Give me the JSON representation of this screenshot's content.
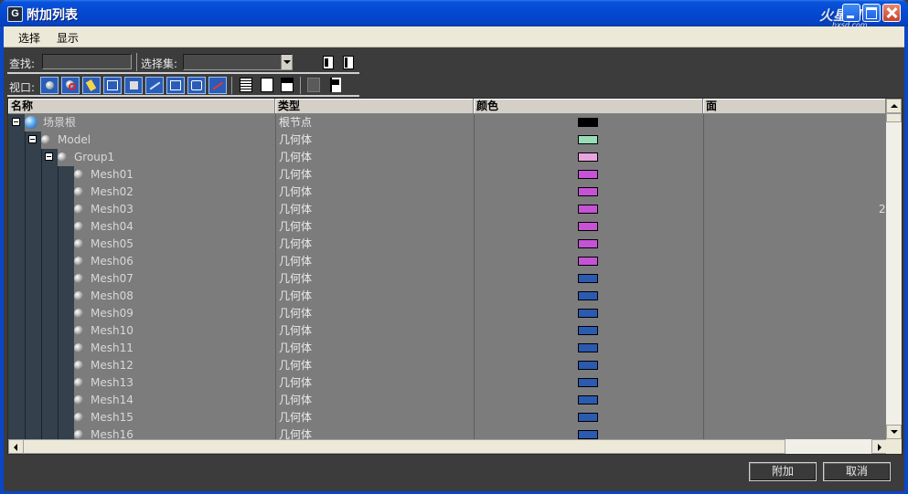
{
  "window": {
    "title": "附加列表",
    "app_icon_label": "G"
  },
  "watermark": {
    "main": "火星网",
    "sub": "hxsd.com"
  },
  "menu": {
    "items": [
      "选择",
      "显示"
    ]
  },
  "toolbar": {
    "find_label": "查找:",
    "find_value": "",
    "selection_set_label": "选择集:",
    "selection_set_value": "",
    "viewport_label": "视口:"
  },
  "list": {
    "columns": [
      "名称",
      "类型",
      "颜色",
      "面"
    ],
    "visible_face_value": "2",
    "rows": [
      {
        "name": "场景根",
        "type": "根节点",
        "color": "#000000",
        "level": 0,
        "icon": "globe-icon",
        "expandable": true
      },
      {
        "name": "Model",
        "type": "几何体",
        "color": "#99dcb8",
        "level": 1,
        "icon": "node-icon",
        "expandable": true
      },
      {
        "name": "Group1",
        "type": "几何体",
        "color": "#e8a4de",
        "level": 2,
        "icon": "node-icon",
        "expandable": true
      },
      {
        "name": "Mesh01",
        "type": "几何体",
        "color": "#c652d6",
        "level": 3,
        "icon": "node-icon",
        "expandable": false
      },
      {
        "name": "Mesh02",
        "type": "几何体",
        "color": "#c652d6",
        "level": 3,
        "icon": "node-icon",
        "expandable": false
      },
      {
        "name": "Mesh03",
        "type": "几何体",
        "color": "#c652d6",
        "level": 3,
        "icon": "node-icon",
        "expandable": false
      },
      {
        "name": "Mesh04",
        "type": "几何体",
        "color": "#c652d6",
        "level": 3,
        "icon": "node-icon",
        "expandable": false
      },
      {
        "name": "Mesh05",
        "type": "几何体",
        "color": "#c652d6",
        "level": 3,
        "icon": "node-icon",
        "expandable": false
      },
      {
        "name": "Mesh06",
        "type": "几何体",
        "color": "#c652d6",
        "level": 3,
        "icon": "node-icon",
        "expandable": false
      },
      {
        "name": "Mesh07",
        "type": "几何体",
        "color": "#2b5ab0",
        "level": 3,
        "icon": "node-icon",
        "expandable": false
      },
      {
        "name": "Mesh08",
        "type": "几何体",
        "color": "#2b5ab0",
        "level": 3,
        "icon": "node-icon",
        "expandable": false
      },
      {
        "name": "Mesh09",
        "type": "几何体",
        "color": "#2b5ab0",
        "level": 3,
        "icon": "node-icon",
        "expandable": false
      },
      {
        "name": "Mesh10",
        "type": "几何体",
        "color": "#2b5ab0",
        "level": 3,
        "icon": "node-icon",
        "expandable": false
      },
      {
        "name": "Mesh11",
        "type": "几何体",
        "color": "#2b5ab0",
        "level": 3,
        "icon": "node-icon",
        "expandable": false
      },
      {
        "name": "Mesh12",
        "type": "几何体",
        "color": "#2b5ab0",
        "level": 3,
        "icon": "node-icon",
        "expandable": false
      },
      {
        "name": "Mesh13",
        "type": "几何体",
        "color": "#2b5ab0",
        "level": 3,
        "icon": "node-icon",
        "expandable": false
      },
      {
        "name": "Mesh14",
        "type": "几何体",
        "color": "#2b5ab0",
        "level": 3,
        "icon": "node-icon",
        "expandable": false
      },
      {
        "name": "Mesh15",
        "type": "几何体",
        "color": "#2b5ab0",
        "level": 3,
        "icon": "node-icon",
        "expandable": false
      },
      {
        "name": "Mesh16",
        "type": "几何体",
        "color": "#2b5ab0",
        "level": 3,
        "icon": "node-icon",
        "expandable": false
      }
    ]
  },
  "buttons": {
    "attach": "附加",
    "cancel": "取消"
  },
  "icons": {
    "viewport_buttons": [
      "geometry-icon",
      "shape-icon",
      "light-icon",
      "camera-icon",
      "helper-icon",
      "spacewarp-icon",
      "group-icon",
      "xref-icon",
      "bone-icon"
    ],
    "list_view_buttons": [
      "list-all-icon",
      "list-none-icon",
      "list-invert-icon",
      "display-subtree-icon",
      "select-dependents-icon"
    ]
  }
}
